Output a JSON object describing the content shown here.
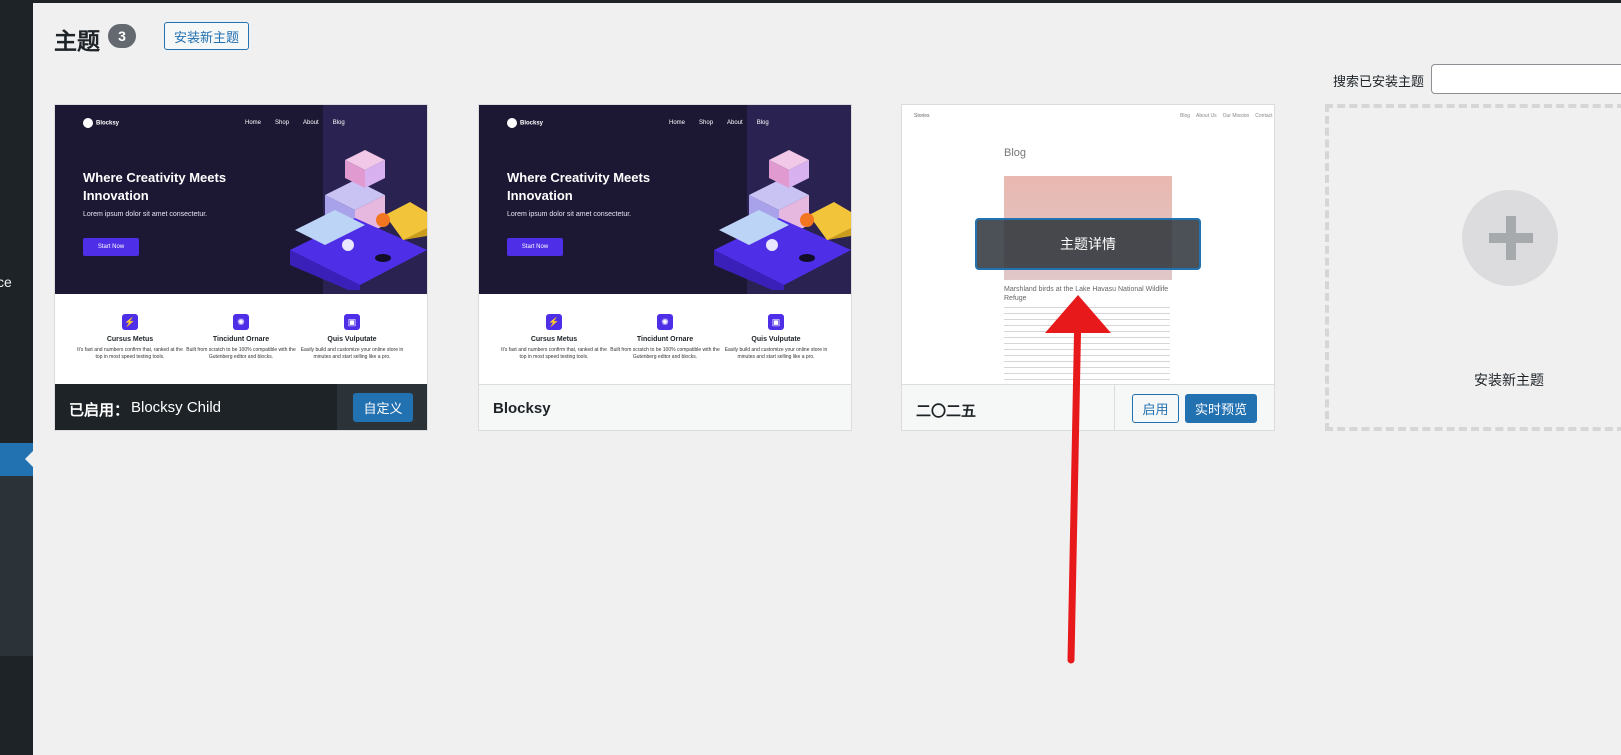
{
  "page": {
    "title": "主题",
    "count": "3",
    "add_new_label": "安装新主题",
    "search_label": "搜索已安装主题",
    "sidebar_edge_text": "ce"
  },
  "themes": [
    {
      "name": "Blocksy Child",
      "active_label": "已启用：",
      "customize_label": "自定义",
      "preview": {
        "logo": "Blocksy",
        "nav": [
          "Home",
          "Shop",
          "About",
          "Blog"
        ],
        "hero_title": "Where Creativity Meets Innovation",
        "hero_sub": "Lorem ipsum dolor sit amet consectetur.",
        "hero_btn": "Start Now",
        "features": [
          {
            "title": "Cursus Metus",
            "desc": "It's fast and numbers confirm that, ranked at the top in most speed testing tools."
          },
          {
            "title": "Tincidunt Ornare",
            "desc": "Built from scratch to be 100% compatible with the Gutenberg editor and blocks."
          },
          {
            "title": "Quis Vulputate",
            "desc": "Easily build and customize your online store in minutes and start selling like a pro."
          }
        ]
      }
    },
    {
      "name": "Blocksy",
      "preview": {
        "logo": "Blocksy",
        "nav": [
          "Home",
          "Shop",
          "About",
          "Blog"
        ],
        "hero_title": "Where Creativity Meets Innovation",
        "hero_sub": "Lorem ipsum dolor sit amet consectetur.",
        "hero_btn": "Start Now",
        "features": [
          {
            "title": "Cursus Metus",
            "desc": "It's fast and numbers confirm that, ranked at the top in most speed testing tools."
          },
          {
            "title": "Tincidunt Ornare",
            "desc": "Built from scratch to be 100% compatible with the Gutenberg editor and blocks."
          },
          {
            "title": "Quis Vulputate",
            "desc": "Easily build and customize your online store in minutes and start selling like a pro."
          }
        ]
      }
    },
    {
      "name": "二〇二五",
      "activate_label": "启用",
      "live_preview_label": "实时预览",
      "details_label": "主题详情",
      "preview": {
        "site": "Stories",
        "nav": [
          "Blog",
          "About Us",
          "Our Mission",
          "Contact"
        ],
        "blog": "Blog",
        "caption": "Marshland birds at the Lake Havasu National Wildlife Refuge"
      }
    }
  ],
  "add_new_card": {
    "label": "安装新主题"
  },
  "colors": {
    "accent": "#2271b1",
    "annotation_arrow": "#e8191a"
  }
}
